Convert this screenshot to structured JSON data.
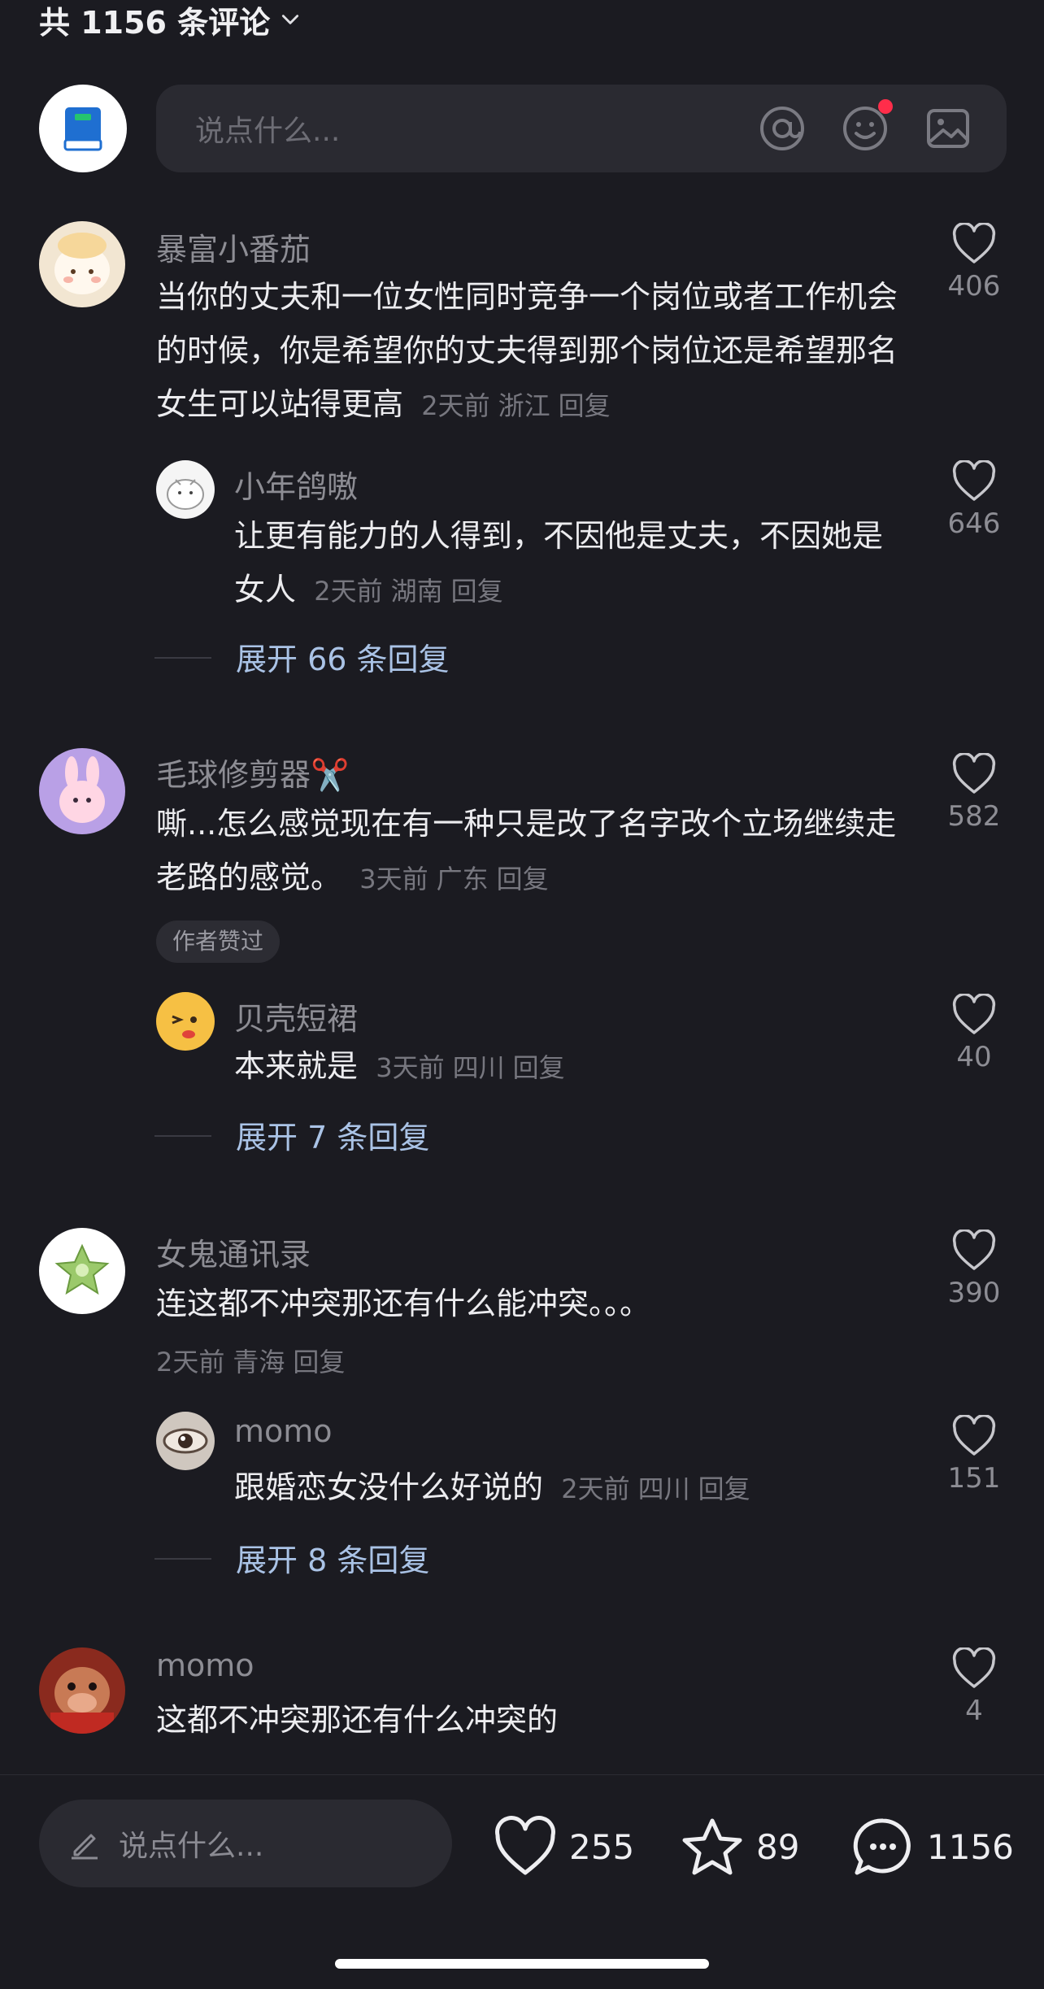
{
  "header": {
    "count_label": "共 1156 条评论"
  },
  "composer": {
    "placeholder": "说点什么...",
    "icons": [
      "at-icon",
      "emoji-icon",
      "image-icon"
    ],
    "notification_dot_color": "#ff2d4a"
  },
  "comments": [
    {
      "user": "暴富小番茄",
      "text": "当你的丈夫和一位女性同时竞争一个岗位或者工作机会的时候，你是希望你的丈夫得到那个岗位还是希望那名女生可以站得更高",
      "time": "2天前",
      "location": "浙江",
      "reply": "回复",
      "likes": "406",
      "replies": [
        {
          "user": "小年鸽嗷",
          "text": "让更有能力的人得到，不因他是丈夫，不因她是女人",
          "time": "2天前",
          "location": "湖南",
          "reply": "回复",
          "likes": "646"
        }
      ],
      "expand_label": "展开 66 条回复"
    },
    {
      "user": "毛球修剪器✂️",
      "text": "嘶...怎么感觉现在有一种只是改了名字改个立场继续走老路的感觉。",
      "time": "3天前",
      "location": "广东",
      "reply": "回复",
      "likes": "582",
      "badge": "作者赞过",
      "replies": [
        {
          "user": "贝壳短裙",
          "text": "本来就是",
          "time": "3天前",
          "location": "四川",
          "reply": "回复",
          "likes": "40"
        }
      ],
      "expand_label": "展开 7 条回复"
    },
    {
      "user": "女鬼通讯录",
      "text": "连这都不冲突那还有什么能冲突。。。",
      "time": "2天前",
      "location": "青海",
      "reply": "回复",
      "likes": "390",
      "replies": [
        {
          "user": "momo",
          "text": "跟婚恋女没什么好说的",
          "time": "2天前",
          "location": "四川",
          "reply": "回复",
          "likes": "151"
        }
      ],
      "expand_label": "展开 8 条回复"
    },
    {
      "user": "momo",
      "text": "这都不冲突那还有什么冲突的",
      "likes": "4"
    }
  ],
  "bottom_bar": {
    "placeholder": "说点什么...",
    "likes": "255",
    "favorites": "89",
    "comments": "1156"
  }
}
